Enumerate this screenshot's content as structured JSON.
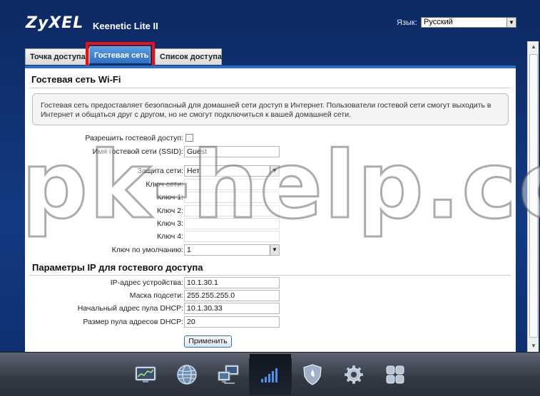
{
  "header": {
    "logo": "ZyXEL",
    "model": "Keenetic Lite II",
    "language_label": "Язык:",
    "language_value": "Русский"
  },
  "tabs": [
    {
      "label": "Точка доступа"
    },
    {
      "label": "Гостевая сеть"
    },
    {
      "label": "Список доступа"
    }
  ],
  "page": {
    "title": "Гостевая сеть Wi-Fi",
    "info": "Гостевая сеть предоставляет безопасный для домашней сети доступ в Интернет. Пользователи гостевой сети смогут выходить в Интернет и общаться друг с другом, но не смогут подключиться к вашей домашней сети."
  },
  "guest_form": {
    "allow_label": "Разрешить гостевой доступ:",
    "ssid_label": "Имя гостевой сети (SSID):",
    "ssid_value": "Guest",
    "security_label": "Защита сети:",
    "security_value": "Нет",
    "netkey_label": "Ключ сети:",
    "key1_label": "Ключ 1:",
    "key2_label": "Ключ 2:",
    "key3_label": "Ключ 3:",
    "key4_label": "Ключ 4:",
    "default_key_label": "Ключ по умолчанию:",
    "default_key_value": "1"
  },
  "ip_section": {
    "title": "Параметры IP для гостевого доступа",
    "ip_label": "IP-адрес устройства:",
    "ip_value": "10.1.30.1",
    "mask_label": "Маска подсети:",
    "mask_value": "255.255.255.0",
    "dhcp_start_label": "Начальный адрес пула DHCP:",
    "dhcp_start_value": "10.1.30.33",
    "pool_size_label": "Размер пула адресов DHCP:",
    "pool_size_value": "20"
  },
  "apply_label": "Применить",
  "watermark": "pk-help.com",
  "dock": {
    "items": [
      {
        "icon": "monitor-chart-icon"
      },
      {
        "icon": "globe-icon"
      },
      {
        "icon": "network-computers-icon"
      },
      {
        "icon": "wifi-signal-icon"
      },
      {
        "icon": "shield-icon"
      },
      {
        "icon": "gear-icon"
      },
      {
        "icon": "grid-apps-icon"
      }
    ]
  }
}
